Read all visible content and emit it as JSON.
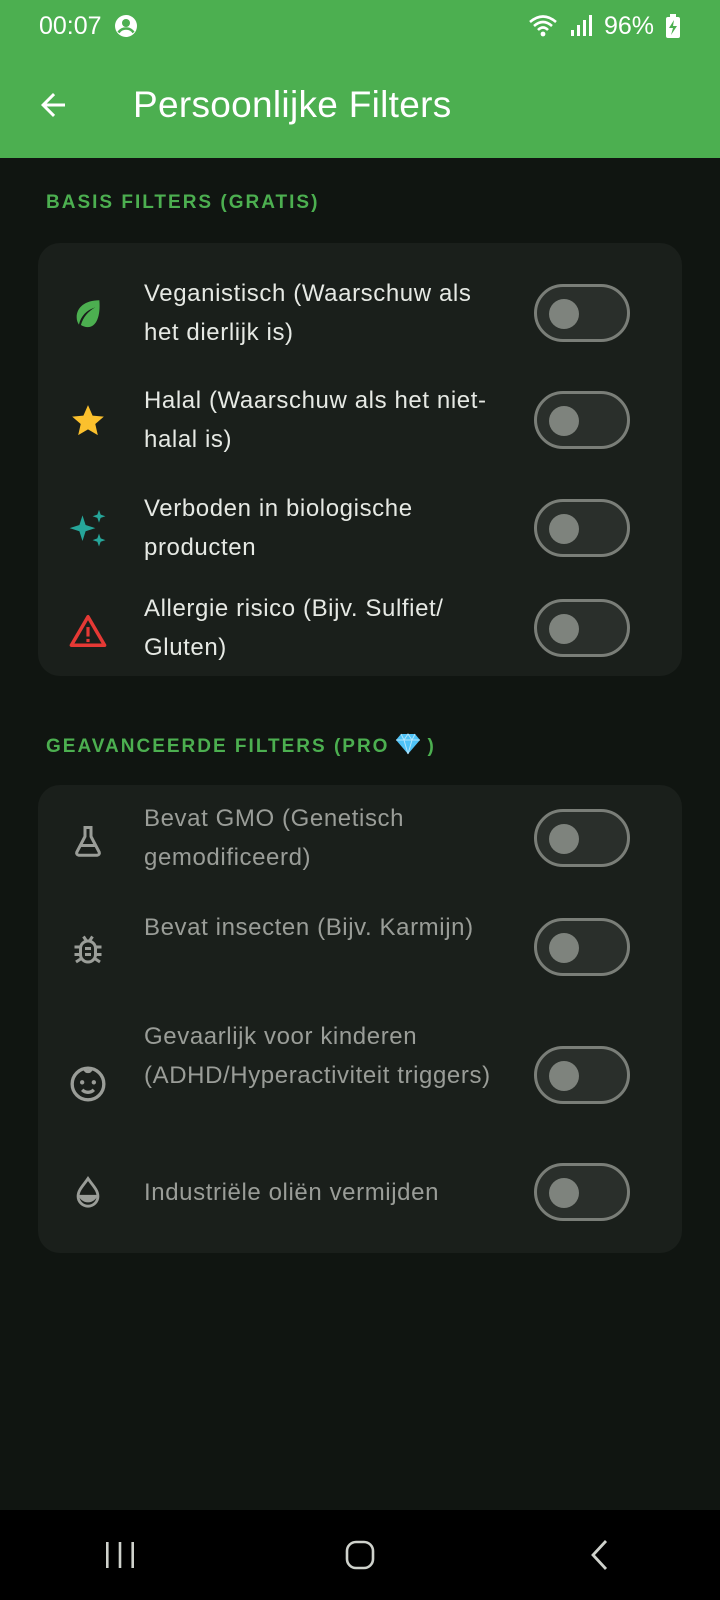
{
  "status_bar": {
    "time": "00:07",
    "battery": "96%"
  },
  "app_bar": {
    "title": "Persoonlijke Filters"
  },
  "sections": [
    {
      "header": "BASIS FILTERS (GRATIS)",
      "items": [
        {
          "label": "Veganistisch (Waarschuw als het dierlijk is)",
          "icon": "leaf-icon",
          "enabled": false
        },
        {
          "label": "Halal (Waarschuw als het niet-halal is)",
          "icon": "star-icon",
          "enabled": false
        },
        {
          "label": "Verboden in biologische producten",
          "icon": "sparkles-icon",
          "enabled": false
        },
        {
          "label": "Allergie risico (Bijv. Sulfiet/ Gluten)",
          "icon": "warning-icon",
          "enabled": false
        }
      ]
    },
    {
      "header": "GEAVANCEERDE FILTERS (PRO",
      "header_suffix": ")",
      "items": [
        {
          "label": "Bevat GMO (Genetisch gemodificeerd)",
          "icon": "flask-icon",
          "enabled": false
        },
        {
          "label": "Bevat insecten (Bijv. Karmijn)",
          "icon": "bug-icon",
          "enabled": false
        },
        {
          "label": "Gevaarlijk voor kinderen (ADHD/Hyperactiviteit triggers)",
          "icon": "child-face-icon",
          "enabled": false
        },
        {
          "label": "Industriële oliën vermijden",
          "icon": "oil-drop-icon",
          "enabled": false
        }
      ]
    }
  ],
  "colors": {
    "primary": "#4caf50",
    "background": "#101511",
    "card": "#1a1f1b",
    "star": "#fbc02d",
    "sparkle": "#26a69a",
    "warning": "#e53935",
    "gem": "#4fc3f7"
  }
}
